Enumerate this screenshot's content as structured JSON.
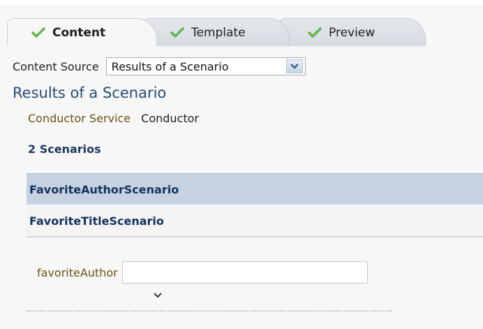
{
  "tabs": [
    {
      "label": "Content",
      "icon": "check-icon",
      "active": true
    },
    {
      "label": "Template",
      "icon": "check-icon",
      "active": false
    },
    {
      "label": "Preview",
      "icon": "check-icon",
      "active": false
    }
  ],
  "content_source": {
    "label": "Content Source",
    "selected": "Results of a Scenario"
  },
  "section": {
    "title": "Results of a Scenario",
    "service_label": "Conductor Service",
    "service_value": "Conductor",
    "count_label": "2 Scenarios"
  },
  "scenarios": [
    {
      "name": "FavoriteAuthorScenario",
      "selected": true
    },
    {
      "name": "FavoriteTitleScenario",
      "selected": false
    }
  ],
  "parameter": {
    "label": "favoriteAuthor",
    "value": ""
  },
  "colors": {
    "check": "#3a9a22",
    "title": "#244d78",
    "label_brown": "#6b5213",
    "selected_row": "#c6d2e1"
  }
}
